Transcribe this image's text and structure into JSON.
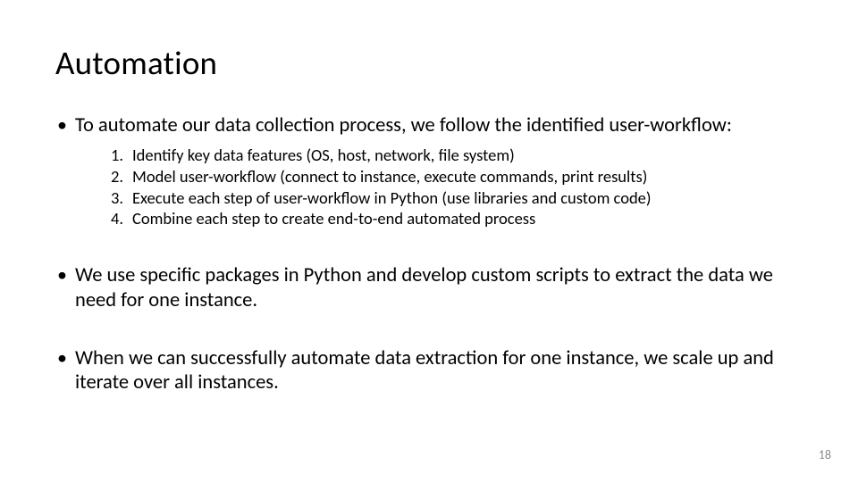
{
  "title": "Automation",
  "bullet1": "To automate our data collection process, we follow the identified user-workflow:",
  "steps": {
    "n1": "1.",
    "t1": "Identify key data features (OS, host, network, file system)",
    "n2": "2.",
    "t2": "Model user-workflow (connect to instance, execute commands, print results)",
    "n3": "3.",
    "t3": "Execute each step of user-workflow in Python (use libraries and custom code)",
    "n4": "4.",
    "t4": "Combine each step to create end-to-end automated process"
  },
  "bullet2": "We use specific packages in Python and develop custom scripts to extract the data we need for one instance.",
  "bullet3": "When we can successfully automate data extraction for one instance, we scale up and iterate over all instances.",
  "pagenum": "18"
}
